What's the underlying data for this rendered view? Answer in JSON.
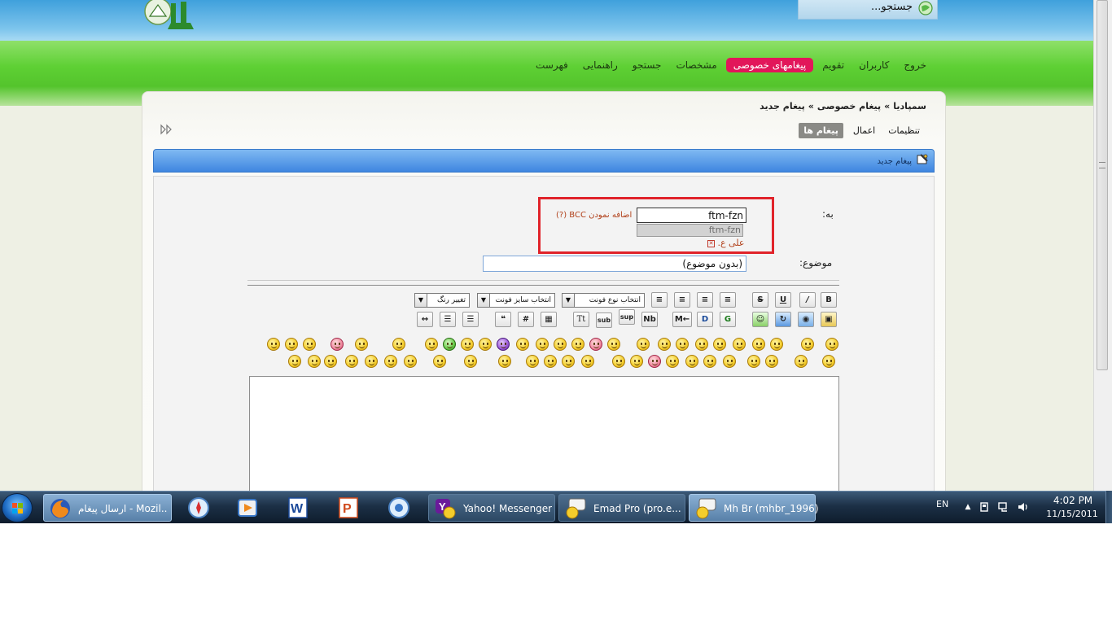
{
  "header": {
    "search_placeholder": "جستجو..."
  },
  "nav": {
    "items": [
      {
        "label": "فهرست"
      },
      {
        "label": "راهنمایی"
      },
      {
        "label": "جستجو"
      },
      {
        "label": "مشخصات"
      },
      {
        "label": "پیغامهای خصوصی"
      },
      {
        "label": "تقویم"
      },
      {
        "label": "کاربران"
      },
      {
        "label": "خروج"
      }
    ],
    "active_index": 4
  },
  "breadcrumb": {
    "items": [
      "سمپادیا",
      "پیغام خصوصی",
      "پیغام جدید"
    ],
    "separator": "»"
  },
  "subtabs": {
    "items": [
      {
        "label": "پیغام ها"
      },
      {
        "label": "اعمال"
      },
      {
        "label": "تنظیمات"
      }
    ]
  },
  "form": {
    "header_title": "پیغام جدید",
    "to_label": "به:",
    "to_value": "ftm-fzn",
    "bcc_link": "اضافه نمودن BCC (?)",
    "autocomplete_suggestion": "ftm-fzn",
    "recipient_chip": "علی ع.",
    "subject_label": "موضوع:",
    "subject_value": "(بدون موضوع)"
  },
  "toolbar": {
    "font_family_label": "انتخاب نوع فونت",
    "font_size_label": "انتخاب سایز فونت",
    "color_label": "تغییر رنگ",
    "bold": "B",
    "underline": "U",
    "strike": "S",
    "sub": "sub",
    "sup": "sup",
    "tt": "Tt",
    "hash": "#",
    "mention": "M",
    "nb": "Nb"
  },
  "taskbar": {
    "tasks": [
      {
        "label": "ارسال پیغام - Mozil...",
        "icon": "firefox-icon"
      },
      {
        "label": "Yahoo! Messenger",
        "icon": "yahoo-messenger-icon"
      },
      {
        "label": "Emad Pro (pro.e...",
        "icon": "chat-icon"
      },
      {
        "label": "Mh Br (mhbr_1996)",
        "icon": "chat-icon"
      }
    ],
    "pinned": [
      "safari-icon",
      "media-player-icon",
      "word-icon",
      "powerpoint-icon",
      "network-icon"
    ],
    "language": "EN",
    "clock_time": "4:02 PM",
    "clock_date": "11/15/2011"
  },
  "colors": {
    "green": "#5ed034",
    "accent_pink": "#e2165a",
    "blue_header": "#3f86e0",
    "highlight_red": "#e0232a"
  }
}
